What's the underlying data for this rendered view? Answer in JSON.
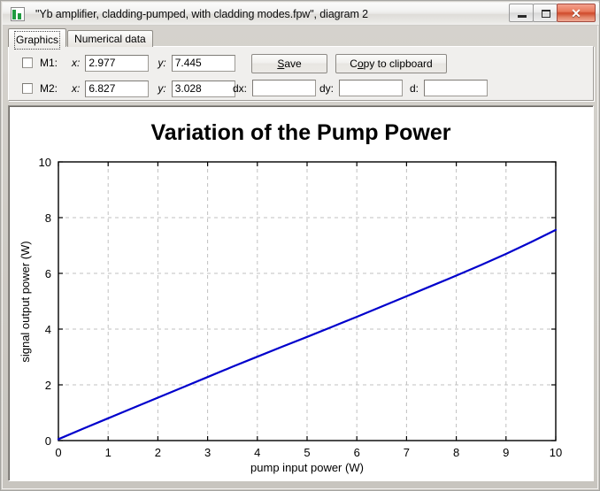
{
  "window": {
    "title": "\"Yb amplifier, cladding-pumped, with cladding modes.fpw\", diagram 2",
    "icon": "chart-app-icon",
    "buttons": {
      "minimize": "minimize-icon",
      "maximize": "maximize-icon",
      "close": "✕"
    }
  },
  "tabs": [
    {
      "label": "Graphics",
      "active": true
    },
    {
      "label": "Numerical data",
      "active": false
    }
  ],
  "toolbar": {
    "markers": [
      {
        "name": "M1:",
        "x_label": "x:",
        "x_value": "2.977",
        "y_label": "y:",
        "y_value": "7.445",
        "checked": false
      },
      {
        "name": "M2:",
        "x_label": "x:",
        "x_value": "6.827",
        "y_label": "y:",
        "y_value": "3.028",
        "checked": false
      }
    ],
    "save_label_pre": "S",
    "save_label_post": "ave",
    "copy_label_pre": "C",
    "copy_label_mid": "o",
    "copy_label_post": "py to clipboard",
    "deltas": [
      {
        "label": "dx:",
        "value": ""
      },
      {
        "label": "dy:",
        "value": ""
      },
      {
        "label": "d:",
        "value": ""
      }
    ]
  },
  "chart_data": {
    "type": "line",
    "title": "Variation of the Pump Power",
    "xlabel": "pump input power (W)",
    "ylabel": "signal output power (W)",
    "xlim": [
      0,
      10
    ],
    "ylim": [
      0,
      10
    ],
    "xticks": [
      0,
      1,
      2,
      3,
      4,
      5,
      6,
      7,
      8,
      9,
      10
    ],
    "yticks": [
      0,
      2,
      4,
      6,
      8,
      10
    ],
    "grid": true,
    "grid_style": "dashed",
    "grid_color": "#c0c0c0",
    "legend": null,
    "series": [
      {
        "name": "signal output power",
        "color": "#0000cc",
        "x": [
          0,
          0.5,
          1,
          1.5,
          2,
          2.5,
          3,
          3.5,
          4,
          4.5,
          5,
          5.5,
          6,
          6.5,
          7,
          7.5,
          8,
          8.5,
          9,
          9.5,
          10
        ],
        "y": [
          0.05,
          0.43,
          0.8,
          1.17,
          1.54,
          1.91,
          2.28,
          2.65,
          3.01,
          3.37,
          3.72,
          4.08,
          4.44,
          4.81,
          5.18,
          5.55,
          5.92,
          6.3,
          6.7,
          7.12,
          7.56
        ]
      }
    ]
  }
}
